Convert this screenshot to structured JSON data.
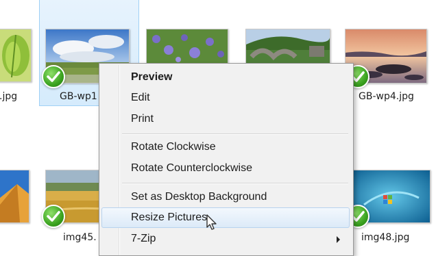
{
  "files": [
    {
      "name": ".jpg",
      "image": "leaf-photo",
      "checked": false
    },
    {
      "name": "GB-wp1",
      "image": "countryside-sky-photo",
      "checked": true,
      "selected": true
    },
    {
      "name": "",
      "image": "bluebell-flowers-photo",
      "checked": false
    },
    {
      "name": "",
      "image": "stone-bridge-photo",
      "checked": false
    },
    {
      "name": "GB-wp4.jpg",
      "image": "coastal-sunset-photo",
      "checked": true
    },
    {
      "name": "",
      "image": "desert-dunes-photo",
      "checked": false
    },
    {
      "name": "img45.",
      "image": "wheat-field-photo",
      "checked": true
    },
    {
      "name": "img48.jpg",
      "image": "windows-aqua-photo",
      "checked": true
    }
  ],
  "context_menu": {
    "items": [
      {
        "label": "Preview",
        "bold": true
      },
      {
        "label": "Edit"
      },
      {
        "label": "Print"
      },
      {
        "separator": true
      },
      {
        "label": "Rotate Clockwise"
      },
      {
        "label": "Rotate Counterclockwise"
      },
      {
        "separator": true
      },
      {
        "label": "Set as Desktop Background"
      },
      {
        "label": "Resize Pictures",
        "highlighted": true
      },
      {
        "label": "7-Zip",
        "submenu": true
      }
    ]
  },
  "icons": {
    "check": "check-badge-icon",
    "submenu": "submenu-arrow-icon",
    "cursor": "mouse-pointer-icon"
  },
  "colors": {
    "selection_bg": "#d5ebfc",
    "selection_border": "#9fd0f5",
    "menu_bg": "#f1f1f1",
    "menu_hover_border": "#b7d2ee",
    "check_green": "#3aa21f"
  }
}
